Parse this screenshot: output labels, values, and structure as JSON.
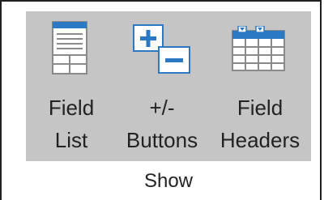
{
  "ribbon_group": {
    "name": "Show",
    "buttons": [
      {
        "label_line1": "Field",
        "label_line2": "List",
        "icon": "field-list-icon"
      },
      {
        "label_line1": "+/-",
        "label_line2": "Buttons",
        "icon": "plus-minus-buttons-icon"
      },
      {
        "label_line1": "Field",
        "label_line2": "Headers",
        "icon": "field-headers-icon"
      }
    ]
  },
  "colors": {
    "group_background": "#c5c5c5",
    "icon_blue": "#2b78c5",
    "icon_border": "#8a8a8a"
  }
}
